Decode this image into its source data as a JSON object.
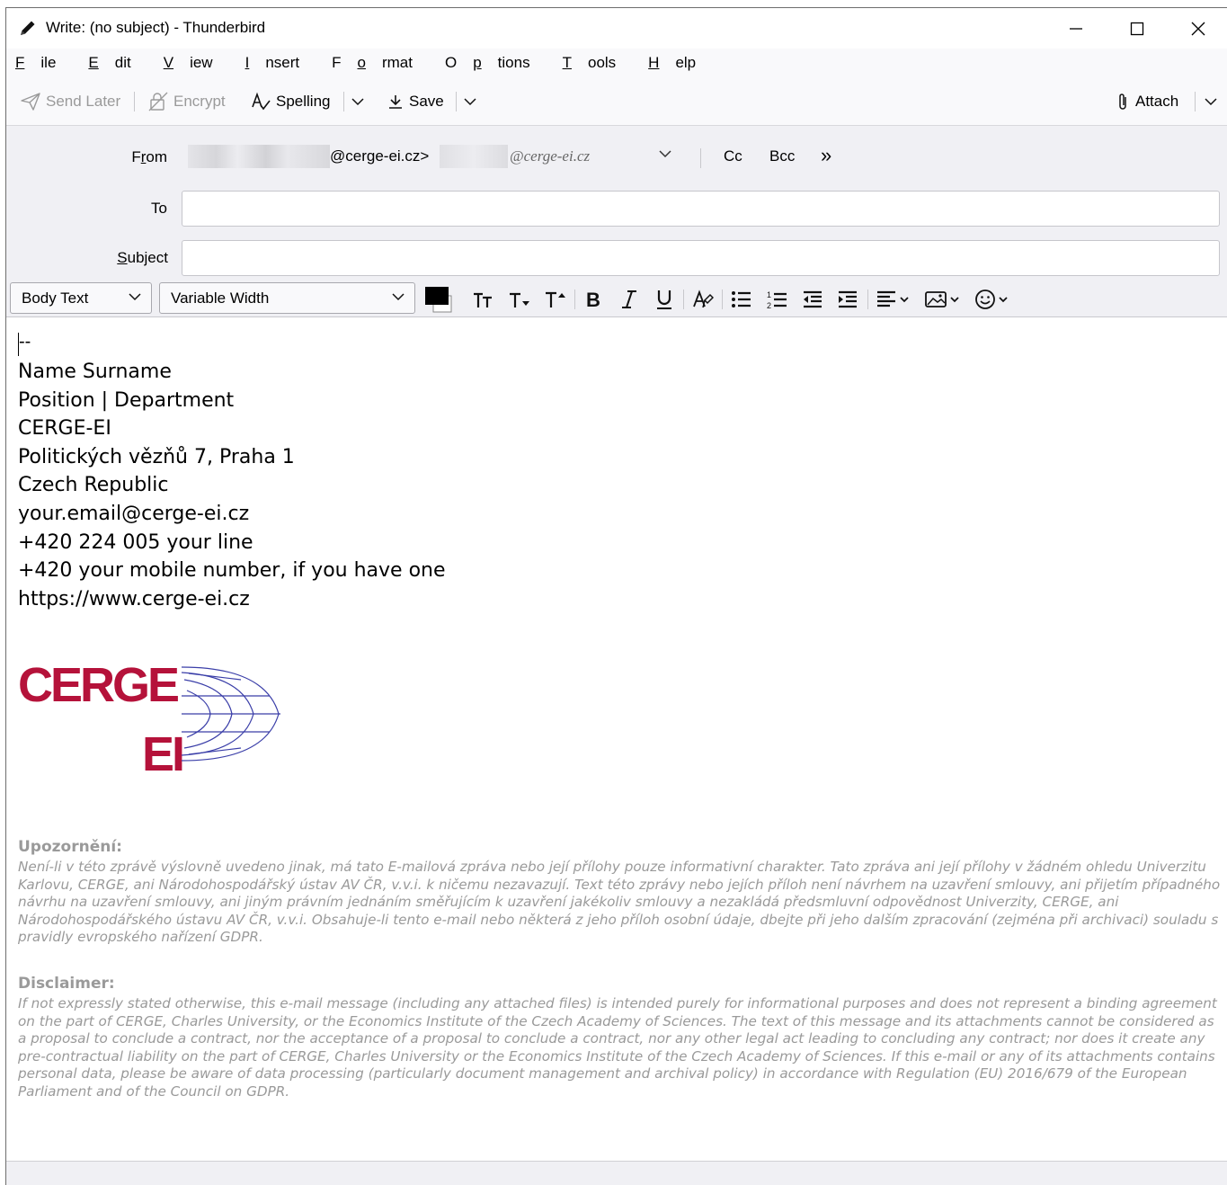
{
  "window": {
    "title": "Write: (no subject) - Thunderbird",
    "minimize_icon": "minimize-icon",
    "maximize_icon": "maximize-icon",
    "close_icon": "close-icon"
  },
  "menu": {
    "items": [
      {
        "label_u": "F",
        "label_rest": "ile"
      },
      {
        "label_u": "E",
        "label_rest": "dit"
      },
      {
        "label_u": "V",
        "label_rest": "iew"
      },
      {
        "label_u": "I",
        "label_rest": "nsert"
      },
      {
        "label_pre": "F",
        "label_u": "o",
        "label_rest": "rmat"
      },
      {
        "label_pre": "O",
        "label_u": "p",
        "label_rest": "tions"
      },
      {
        "label_u": "T",
        "label_rest": "ools"
      },
      {
        "label_u": "H",
        "label_rest": "elp"
      }
    ]
  },
  "toolbar": {
    "send_later": "Send Later",
    "encrypt": "Encrypt",
    "spelling": "Spelling",
    "save": "Save",
    "attach": "Attach"
  },
  "headers": {
    "from_label_pre": "F",
    "from_label_u": "r",
    "from_label_rest": "om",
    "from_address_visible": "@cerge-ei.cz>",
    "from_identity_visible": "@cerge-ei.cz",
    "cc": "Cc",
    "bcc": "Bcc",
    "more": "»",
    "to_label": "To",
    "to_value": "",
    "subject_label_u": "S",
    "subject_label_rest": "ubject",
    "subject_value": ""
  },
  "format": {
    "paragraph_style": "Body Text",
    "font": "Variable Width",
    "text_color": "#000000",
    "bg_color": "#ffffff"
  },
  "body": {
    "separator": "--",
    "signature": [
      "Name Surname",
      "Position | Department",
      "CERGE-EI",
      "Politických vězňů 7, Praha 1",
      "Czech Republic",
      "your.email@cerge-ei.cz",
      "+420 224 005 your line",
      "+420 your mobile number, if you have one",
      "https://www.cerge-ei.cz"
    ],
    "logo": {
      "line1": "CERGE",
      "line2": "EI",
      "color": "#b5123a",
      "globe_color": "#3a3ea8"
    },
    "disclaimer_cz_title": "Upozornění:",
    "disclaimer_cz_text": "Není-li v této zprávě výslovně uvedeno jinak, má tato E-mailová zpráva nebo její přílohy pouze informativní charakter. Tato zpráva ani její přílohy v žádném ohledu Univerzitu Karlovu, CERGE, ani Národohospodářský ústav AV ČR, v.v.i. k ničemu nezavazují. Text této zprávy nebo jejích příloh není návrhem na uzavření smlouvy, ani přijetím případného návrhu na uzavření smlouvy, ani jiným právním jednáním směřujícím k uzavření jakékoliv smlouvy a nezakládá předsmluvní odpovědnost Univerzity, CERGE, ani Národohospodářského ústavu AV ČR, v.v.i. Obsahuje-li tento e-mail nebo některá z jeho příloh osobní údaje, dbejte při jeho dalším zpracování (zejména při archivaci) souladu s pravidly evropského nařízení GDPR.",
    "disclaimer_en_title": "Disclaimer:",
    "disclaimer_en_text": "If not expressly stated otherwise, this e-mail message (including any attached files) is intended purely for informational purposes and does not represent a binding agreement on the part of CERGE, Charles University, or the Economics Institute of the Czech Academy of Sciences. The text of this message and its attachments cannot be considered as a proposal to conclude a contract, nor the acceptance of a proposal to conclude a contract, nor any other legal act leading to concluding any contract; nor does it create any pre-contractual liability on the part of CERGE, Charles University or the Economics Institute of the Czech Academy of Sciences. If this e-mail or any of its attachments contains personal data, please be aware of data processing (particularly document management and archival policy) in accordance with Regulation (EU) 2016/679 of the European Parliament and of the Council on GDPR."
  }
}
